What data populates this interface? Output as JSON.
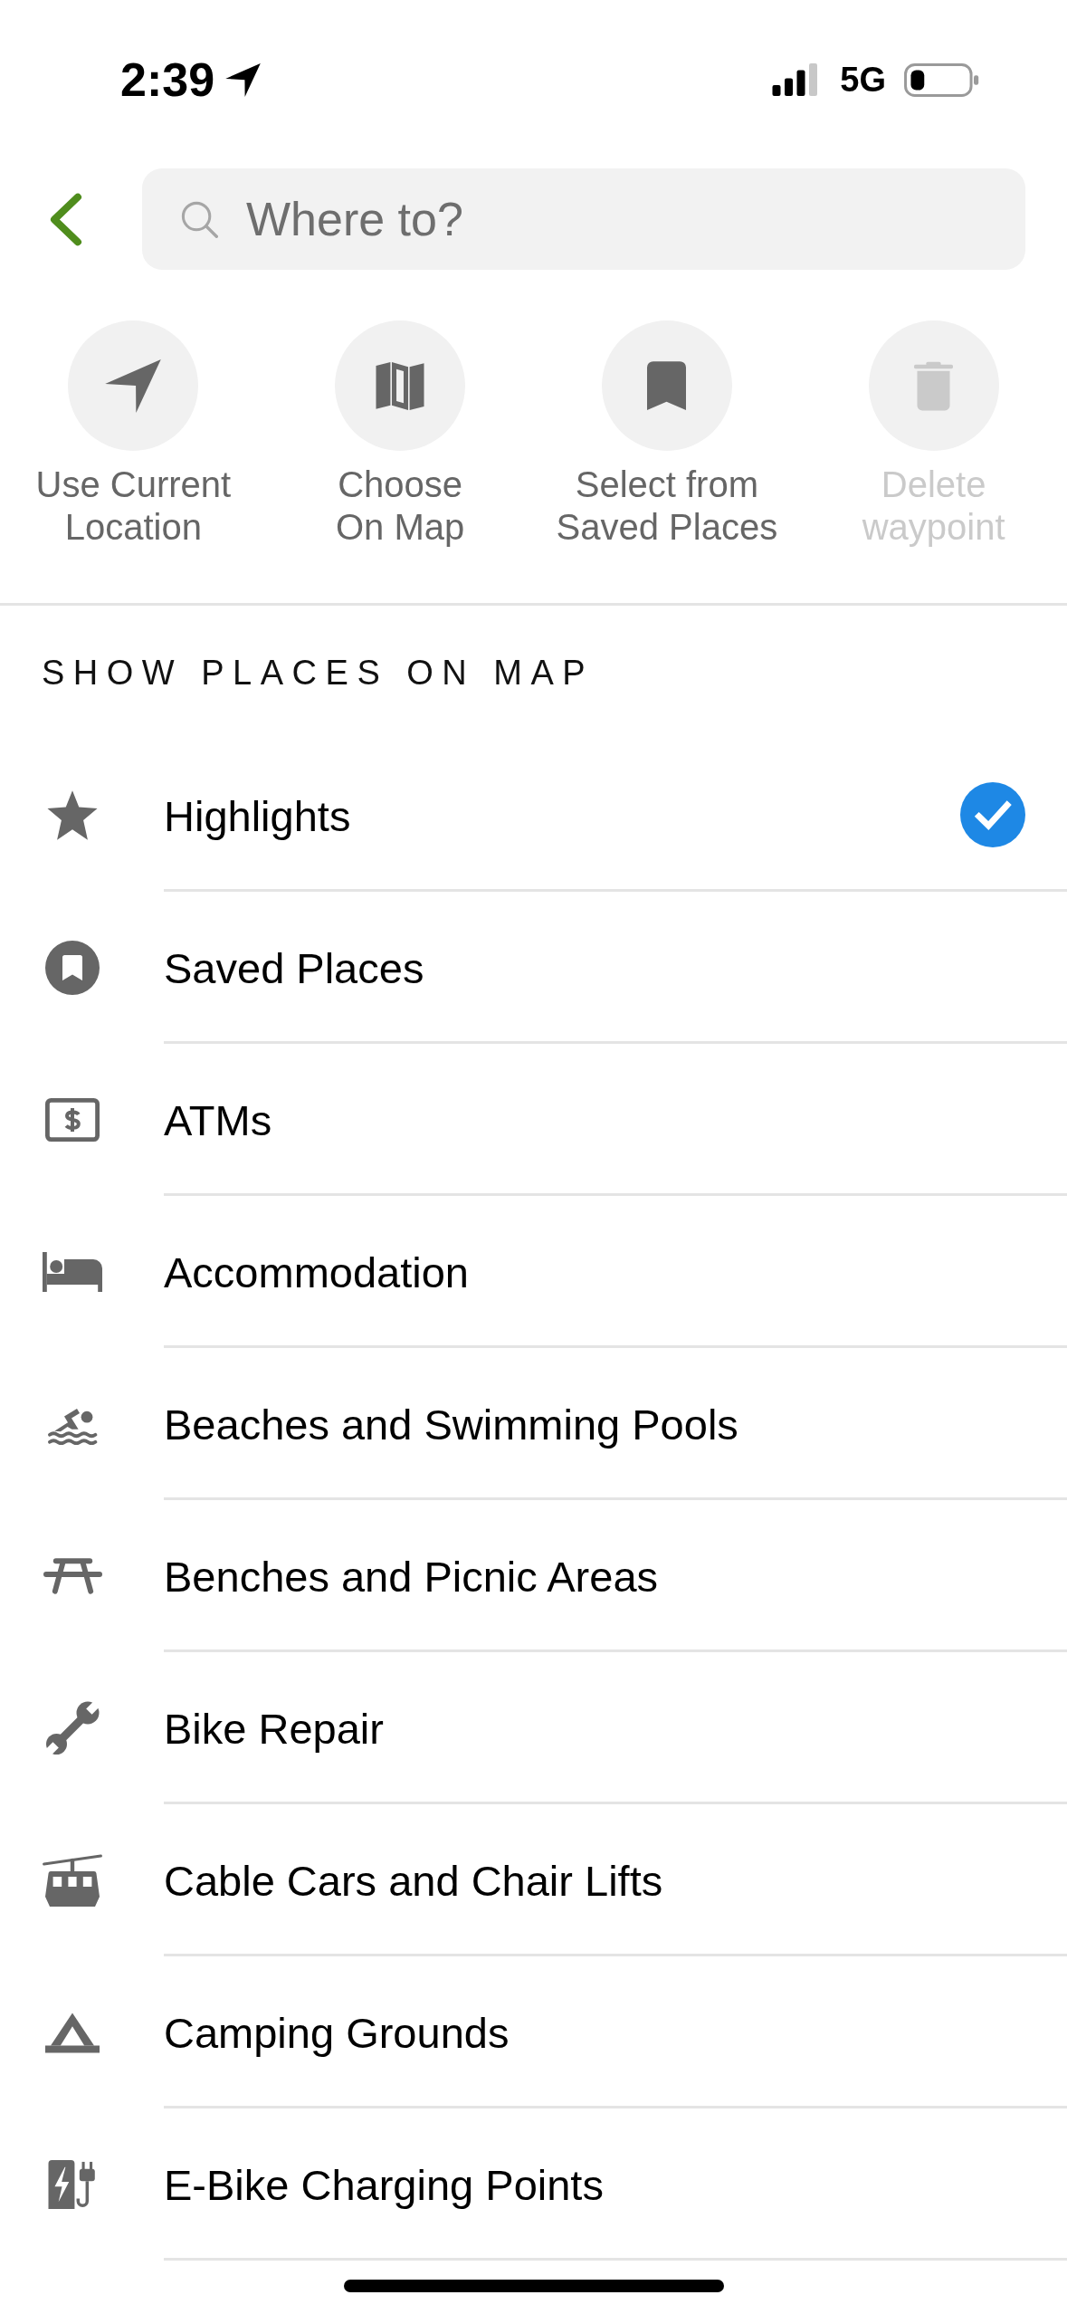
{
  "status_bar": {
    "time": "2:39",
    "network": "5G"
  },
  "search": {
    "placeholder": "Where to?"
  },
  "actions": [
    {
      "label": "Use Current\nLocation",
      "disabled": false
    },
    {
      "label": "Choose\nOn Map",
      "disabled": false
    },
    {
      "label": "Select from\nSaved Places",
      "disabled": false
    },
    {
      "label": "Delete\nwaypoint",
      "disabled": true
    }
  ],
  "places": {
    "title": "SHOW PLACES ON MAP",
    "items": [
      {
        "label": "Highlights",
        "checked": true
      },
      {
        "label": "Saved Places",
        "checked": false
      },
      {
        "label": "ATMs",
        "checked": false
      },
      {
        "label": "Accommodation",
        "checked": false
      },
      {
        "label": "Beaches and Swimming Pools",
        "checked": false
      },
      {
        "label": "Benches and Picnic Areas",
        "checked": false
      },
      {
        "label": "Bike Repair",
        "checked": false
      },
      {
        "label": "Cable Cars and Chair Lifts",
        "checked": false
      },
      {
        "label": "Camping Grounds",
        "checked": false
      },
      {
        "label": "E-Bike Charging Points",
        "checked": false
      }
    ]
  }
}
